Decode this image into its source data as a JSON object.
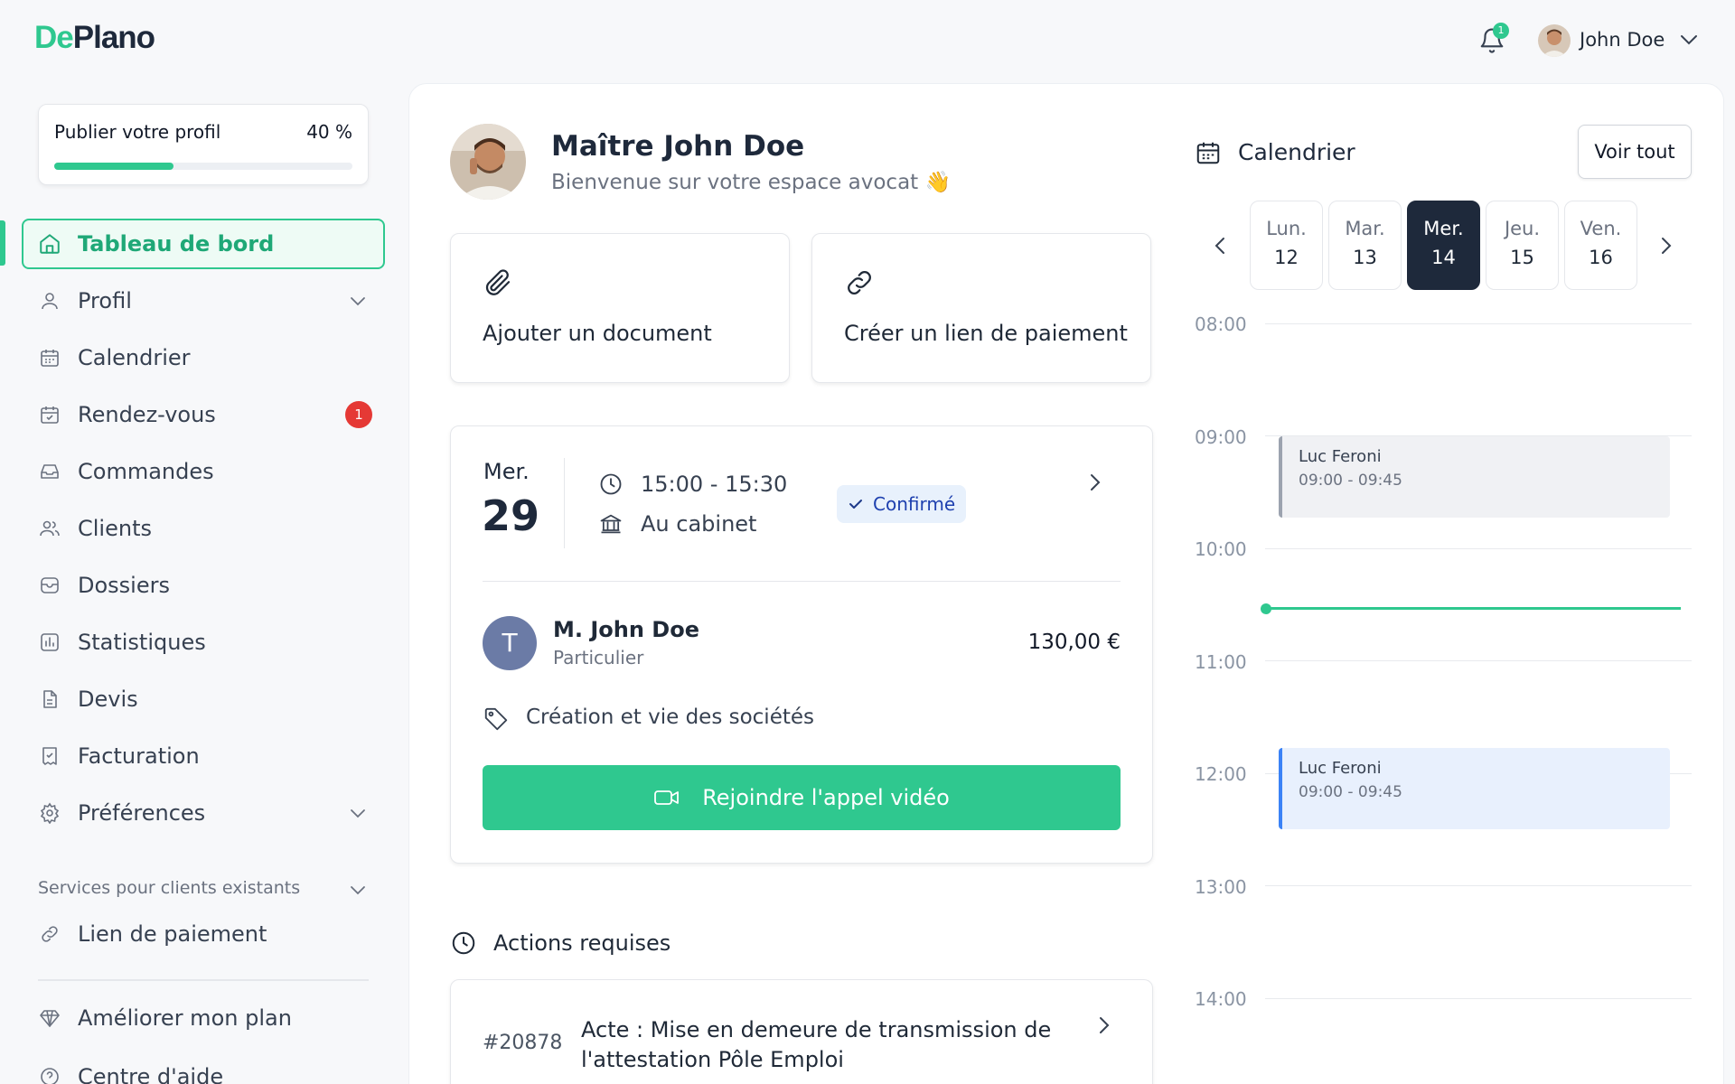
{
  "brand": {
    "part1": "De",
    "part2": "Plano",
    "accent": "#2fc88f"
  },
  "header": {
    "notification_count": "1",
    "user_name": "John Doe"
  },
  "sidebar": {
    "profile_card": {
      "title": "Publier votre profil",
      "percent_label": "40 %",
      "progress": 0.4
    },
    "items": [
      {
        "label": "Tableau de bord",
        "icon": "home-icon",
        "active": true
      },
      {
        "label": "Profil",
        "icon": "user-icon",
        "expandable": true
      },
      {
        "label": "Calendrier",
        "icon": "calendar-icon"
      },
      {
        "label": "Rendez-vous",
        "icon": "calendar-check-icon",
        "badge": "1"
      },
      {
        "label": "Commandes",
        "icon": "inbox-icon"
      },
      {
        "label": "Clients",
        "icon": "users-icon"
      },
      {
        "label": "Dossiers",
        "icon": "folder-icon"
      },
      {
        "label": "Statistiques",
        "icon": "chart-icon"
      },
      {
        "label": "Devis",
        "icon": "document-icon"
      },
      {
        "label": "Facturation",
        "icon": "receipt-icon"
      },
      {
        "label": "Préférences",
        "icon": "gear-icon",
        "expandable": true
      }
    ],
    "section_label": "Services pour clients existants",
    "section_items": [
      {
        "label": "Lien de paiement",
        "icon": "link-icon"
      }
    ],
    "bottom_items": [
      {
        "label": "Améliorer mon plan",
        "icon": "diamond-icon"
      },
      {
        "label": "Centre d'aide",
        "icon": "help-icon"
      }
    ]
  },
  "main": {
    "title": "Maître John Doe",
    "subtitle": "Bienvenue sur votre espace avocat 👋",
    "actions": [
      {
        "label": "Ajouter un document",
        "icon": "paperclip-icon"
      },
      {
        "label": "Créer un lien de paiement",
        "icon": "link-icon"
      }
    ],
    "appointment": {
      "day_of_week": "Mer.",
      "day": "29",
      "time": "15:00 - 15:30",
      "location": "Au cabinet",
      "status": "Confirmé",
      "client_initial": "T",
      "client_name": "M. John Doe",
      "client_type": "Particulier",
      "price": "130,00 €",
      "category": "Création et vie des sociétés",
      "join_label": "Rejoindre l'appel vidéo"
    },
    "actions_required": {
      "title": "Actions requises",
      "tasks": [
        {
          "id": "#20878",
          "title": "Acte : Mise en demeure de transmission de l'attestation Pôle Emploi"
        }
      ]
    }
  },
  "calendar": {
    "title": "Calendrier",
    "see_all": "Voir tout",
    "days": [
      {
        "dow": "Lun.",
        "num": "12"
      },
      {
        "dow": "Mar.",
        "num": "13"
      },
      {
        "dow": "Mer.",
        "num": "14",
        "selected": true
      },
      {
        "dow": "Jeu.",
        "num": "15"
      },
      {
        "dow": "Ven.",
        "num": "16"
      }
    ],
    "hours": [
      "08:00",
      "09:00",
      "10:00",
      "11:00",
      "12:00",
      "13:00",
      "14:00"
    ],
    "events": [
      {
        "name": "Luc Feroni",
        "time": "09:00 - 09:45"
      },
      {
        "name": "Luc Feroni",
        "time": "09:00 - 09:45"
      }
    ]
  }
}
